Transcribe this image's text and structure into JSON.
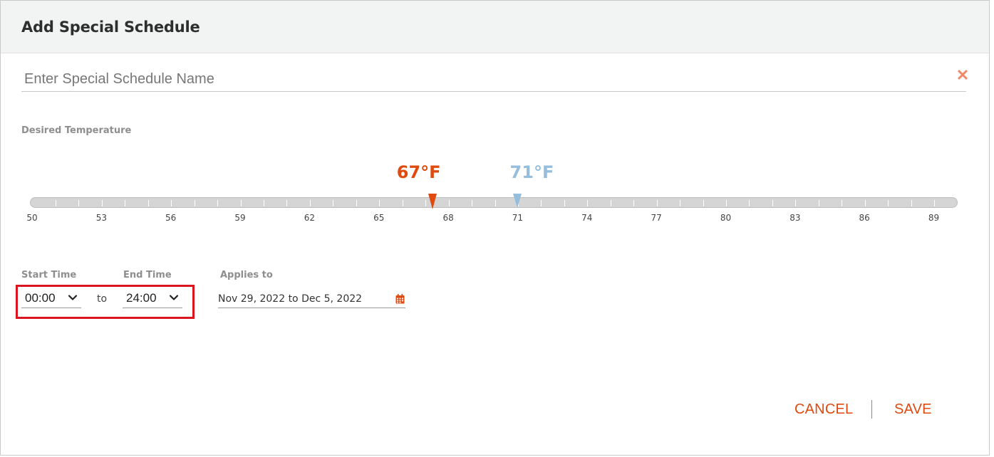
{
  "dialog": {
    "title": "Add Special Schedule",
    "name_placeholder": "Enter Special Schedule Name",
    "close_symbol": "✕"
  },
  "temperature": {
    "label": "Desired Temperature",
    "low": {
      "value": 67,
      "display": "67°F",
      "color": "#e04a0f"
    },
    "high": {
      "value": 71,
      "display": "71°F",
      "color": "#94bedb"
    },
    "scale_min": 50,
    "scale_max": 90,
    "tick_labels": [
      "50",
      "53",
      "56",
      "59",
      "62",
      "65",
      "68",
      "71",
      "74",
      "77",
      "80",
      "83",
      "86",
      "89"
    ]
  },
  "time": {
    "start_label": "Start Time",
    "end_label": "End Time",
    "start_value": "00:00",
    "end_value": "24:00",
    "to_text": "to"
  },
  "applies": {
    "label": "Applies to",
    "value": "Nov 29, 2022 to Dec 5, 2022"
  },
  "footer": {
    "cancel_label": "CANCEL",
    "save_label": "SAVE"
  },
  "colors": {
    "accent": "#e04a0f",
    "cool": "#94bedb",
    "highlight": "#d9151f"
  }
}
